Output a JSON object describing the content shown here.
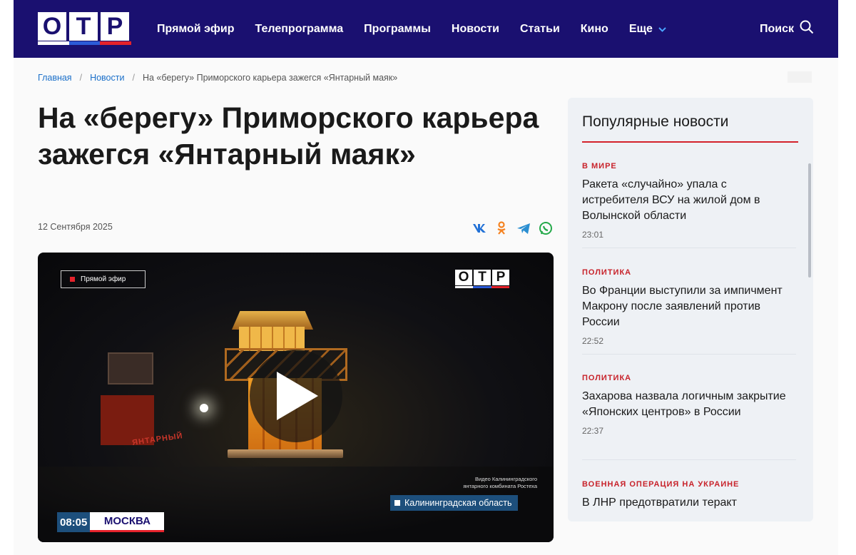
{
  "header": {
    "logo_letters": [
      "О",
      "Т",
      "Р"
    ],
    "logo_stripe_colors": [
      "#ffffff",
      "#2c5bd8",
      "#e5222b"
    ],
    "nav": [
      {
        "label": "Прямой эфир"
      },
      {
        "label": "Телепрограмма"
      },
      {
        "label": "Программы"
      },
      {
        "label": "Новости"
      },
      {
        "label": "Статьи"
      },
      {
        "label": "Кино"
      },
      {
        "label": "Еще"
      }
    ],
    "search_label": "Поиск",
    "colors": {
      "bar": "#1a1070",
      "accent": "#4aa3ff"
    }
  },
  "breadcrumb": {
    "home": "Главная",
    "section": "Новости",
    "current": "На «берегу» Приморского карьера зажегся «Янтарный маяк»"
  },
  "article": {
    "title": "На «берегу» Приморского карьера зажегся «Янтарный маяк»",
    "date": "12 Сентября 2025",
    "share_icons": [
      "vk-icon",
      "odnoklassniki-icon",
      "telegram-icon",
      "whatsapp-icon"
    ]
  },
  "video": {
    "live_label": "Прямой эфир",
    "logo_letters": [
      "О",
      "Т",
      "Р"
    ],
    "sign_text": "ЯНТАРНЫЙ",
    "credit_line1": "Видео Калининградского",
    "credit_line2": "янтарного комбината Ростеха",
    "region": "Калининградская область",
    "time": "08:05",
    "city": "МОСКВА"
  },
  "sidebar": {
    "title": "Популярные новости",
    "items": [
      {
        "category": "В МИРЕ",
        "headline": "Ракета «случайно» упала с истребителя ВСУ на жилой дом в Волынской области",
        "time": "23:01"
      },
      {
        "category": "ПОЛИТИКА",
        "headline": "Во Франции выступили за импичмент Макрону после заявлений против России",
        "time": "22:52"
      },
      {
        "category": "ПОЛИТИКА",
        "headline": "Захарова назвала логичным закрытие «Японских центров» в России",
        "time": "22:37"
      },
      {
        "category": "ВОЕННАЯ ОПЕРАЦИЯ НА УКРАИНЕ",
        "headline": "В ЛНР предотвратили теракт",
        "time": ""
      }
    ]
  }
}
